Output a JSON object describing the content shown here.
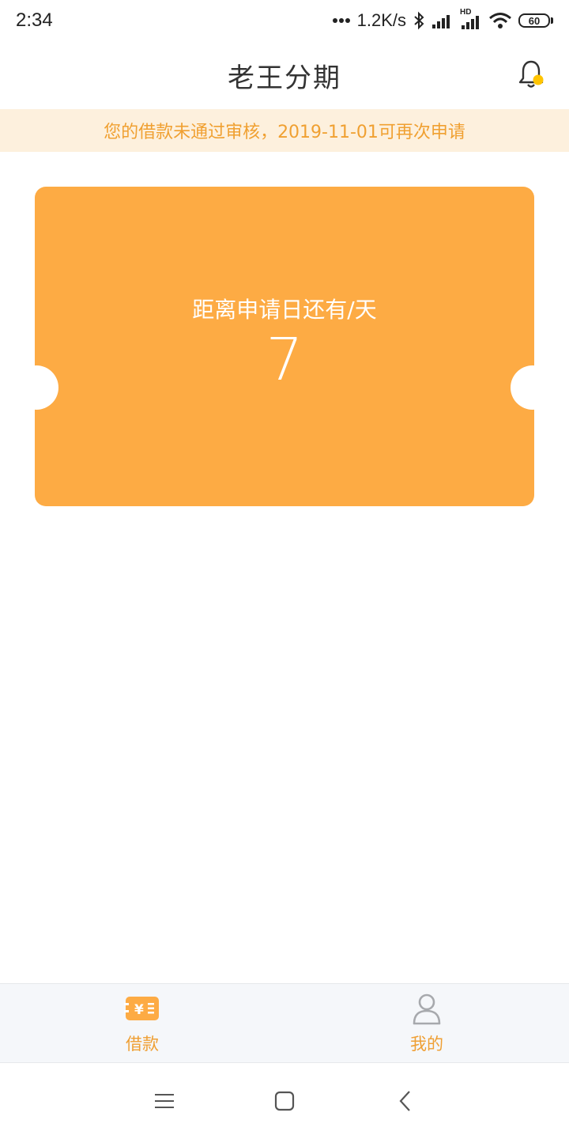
{
  "status_bar": {
    "time": "2:34",
    "network_speed": "1.2K/s",
    "hd_badge": "HD",
    "battery_level": "60",
    "icons": [
      "dots-icon",
      "bluetooth-icon",
      "signal-icon",
      "signal-hd-icon",
      "wifi-icon",
      "battery-icon"
    ]
  },
  "header": {
    "title": "老王分期",
    "bell_icon": "bell-icon",
    "bell_badge_color": "#ffc400"
  },
  "notice": {
    "text": "您的借款未通过审核，2019-11-01可再次申请"
  },
  "countdown_card": {
    "label": "距离申请日还有/天",
    "days": "7",
    "color": "#fdab44"
  },
  "tab_bar": {
    "tabs": [
      {
        "label": "借款",
        "icon": "loan-icon",
        "active": true
      },
      {
        "label": "我的",
        "icon": "user-icon",
        "active": false
      }
    ],
    "accent": "#ef9f33"
  },
  "nav_bar": {
    "buttons": [
      "menu-icon",
      "home-icon",
      "back-icon"
    ]
  }
}
